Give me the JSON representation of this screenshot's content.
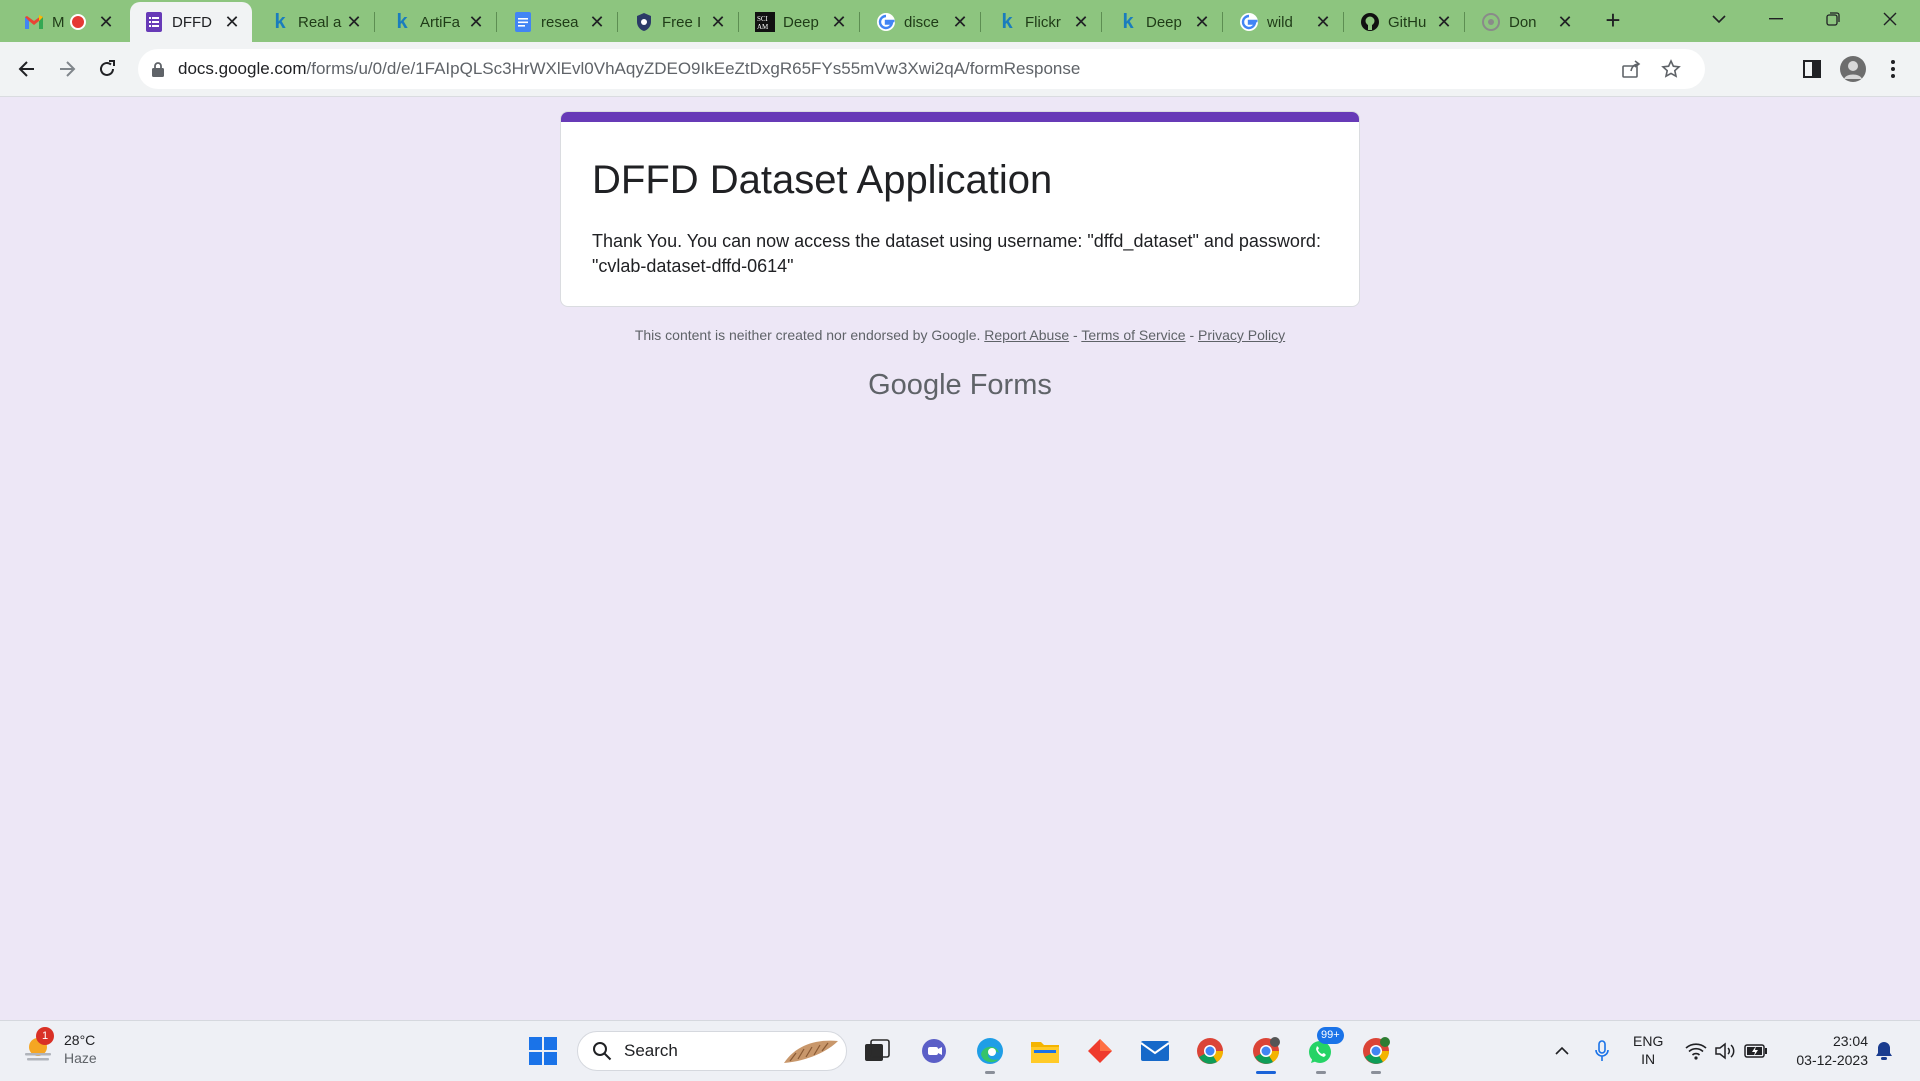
{
  "browser": {
    "tabs": [
      {
        "icon": "gmail-icon",
        "title": "M"
      },
      {
        "icon": "google-forms-icon",
        "title": "DFFD"
      },
      {
        "icon": "kaggle-icon",
        "title": "Real a"
      },
      {
        "icon": "kaggle-icon",
        "title": "ArtiFa"
      },
      {
        "icon": "google-docs-icon",
        "title": "resea"
      },
      {
        "icon": "shield-icon",
        "title": "Free I"
      },
      {
        "icon": "scientific-american-icon",
        "title": "Deep"
      },
      {
        "icon": "google-icon",
        "title": "disce"
      },
      {
        "icon": "kaggle-icon",
        "title": "Flickr"
      },
      {
        "icon": "kaggle-icon",
        "title": "Deep"
      },
      {
        "icon": "google-icon",
        "title": "wild"
      },
      {
        "icon": "github-icon",
        "title": "GitHu"
      },
      {
        "icon": "site-icon",
        "title": "Don"
      }
    ],
    "active_tab": 1,
    "url_host": "docs.google.com",
    "url_path": "/forms/u/0/d/e/1FAIpQLSc3HrWXlEvl0VhAqyZDEO9IkEeZtDxgR65FYs55mVw3Xwi2qA/formResponse"
  },
  "form": {
    "title": "DFFD Dataset Application",
    "message": "Thank You. You can now access the dataset using username: \"dffd_dataset\" and password: \"cvlab-dataset-dffd-0614\"",
    "accent_color": "#673ab7"
  },
  "footer": {
    "note": "This content is neither created nor endorsed by Google.",
    "report_abuse": "Report Abuse",
    "terms": "Terms of Service",
    "privacy": "Privacy Policy",
    "sep": "-",
    "brand_google": "Google",
    "brand_product": "Forms"
  },
  "taskbar": {
    "weather_badge": "1",
    "temperature": "28°C",
    "condition": "Haze",
    "search_placeholder": "Search",
    "whatsapp_badge": "99+",
    "lang_line1": "ENG",
    "lang_line2": "IN",
    "time": "23:04",
    "date": "03-12-2023"
  }
}
